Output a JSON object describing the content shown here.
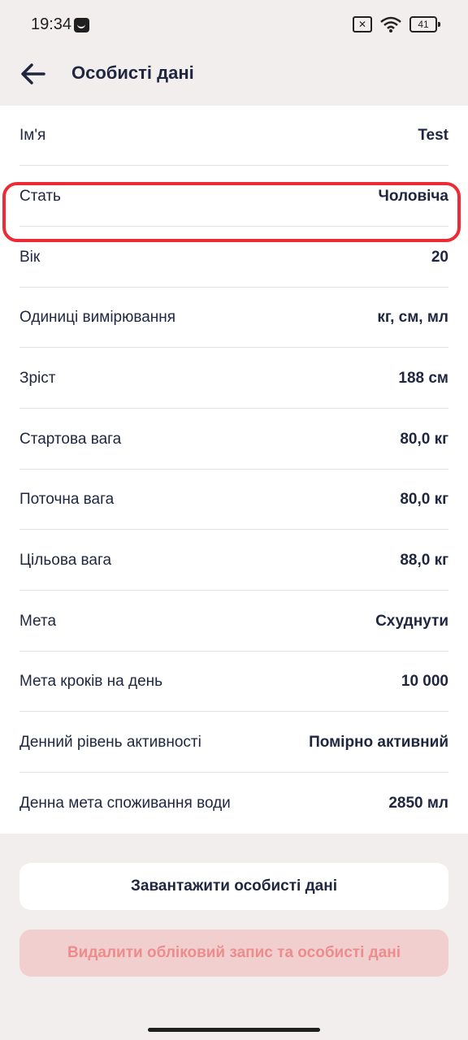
{
  "status": {
    "time": "19:34",
    "battery": "41",
    "icons": [
      "app-notification-icon",
      "no-sim-icon",
      "wifi-icon",
      "battery-icon"
    ]
  },
  "header": {
    "title": "Особисті дані"
  },
  "rows": [
    {
      "label": "Ім'я",
      "value": "Test"
    },
    {
      "label": "Стать",
      "value": "Чоловіча"
    },
    {
      "label": "Вік",
      "value": "20"
    },
    {
      "label": "Одиниці вимірювання",
      "value": "кг, см, мл"
    },
    {
      "label": "Зріст",
      "value": "188 см"
    },
    {
      "label": "Стартова вага",
      "value": "80,0 кг"
    },
    {
      "label": "Поточна вага",
      "value": "80,0 кг"
    },
    {
      "label": "Цільова вага",
      "value": "88,0 кг"
    },
    {
      "label": "Мета",
      "value": "Схуднути"
    },
    {
      "label": "Мета кроків на день",
      "value": "10 000"
    },
    {
      "label": "Денний рівень активності",
      "value": "Помірно активний"
    },
    {
      "label": "Денна мета споживання води",
      "value": "2850 мл"
    }
  ],
  "actions": {
    "download_label": "Завантажити особисті дані",
    "delete_label": "Видалити обліковий запис та особисті дані"
  },
  "colors": {
    "highlight": "#ee2b34",
    "delete_text": "#ec8c8c",
    "delete_bg": "#f2cfcf",
    "text": "#1f2640"
  }
}
